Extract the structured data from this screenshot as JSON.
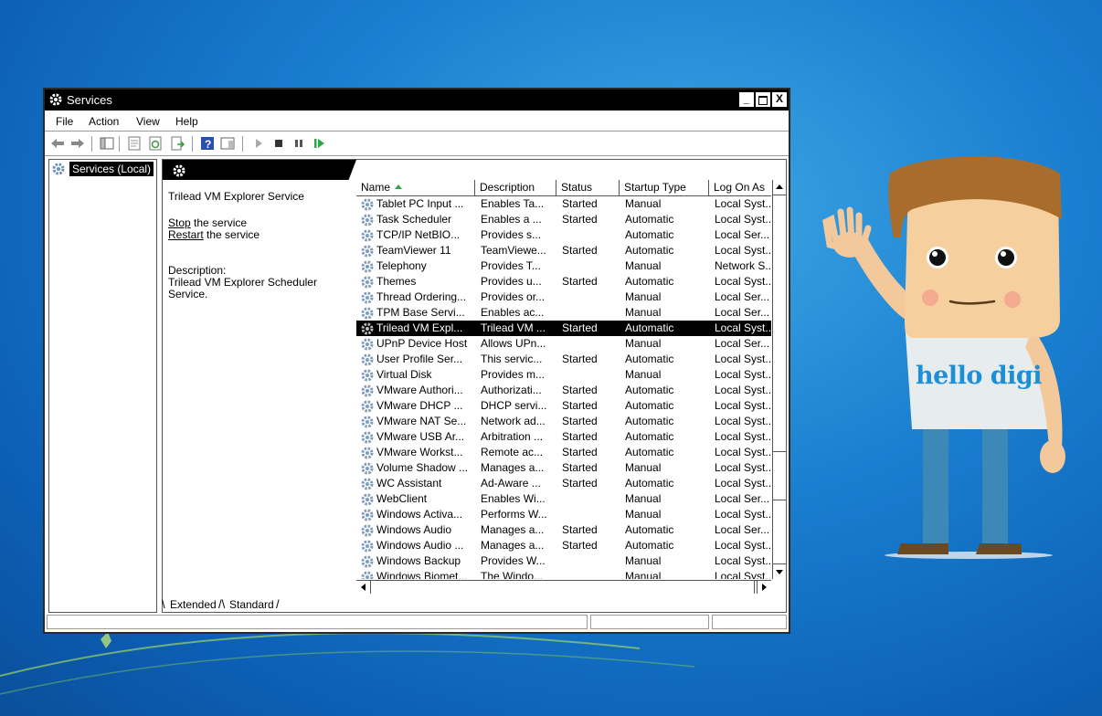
{
  "window": {
    "title": "Services",
    "controls": {
      "minimize": "_",
      "close": "X"
    }
  },
  "menu": [
    "File",
    "Action",
    "View",
    "Help"
  ],
  "tree": {
    "root": "Services (Local)"
  },
  "extended": {
    "service_name": "Trilead VM Explorer Service",
    "stop_link": "Stop",
    "stop_suffix": " the service",
    "restart_link": "Restart",
    "restart_suffix": " the service",
    "description_label": "Description:",
    "description": "Trilead VM Explorer Scheduler Service."
  },
  "columns": [
    "Name",
    "Description",
    "Status",
    "Startup Type",
    "Log On As"
  ],
  "services": [
    {
      "name": "Tablet PC Input ...",
      "description": "Enables Ta...",
      "status": "Started",
      "startup": "Manual",
      "logon": "Local Syst..."
    },
    {
      "name": "Task Scheduler",
      "description": "Enables a ...",
      "status": "Started",
      "startup": "Automatic",
      "logon": "Local Syst..."
    },
    {
      "name": "TCP/IP NetBIO...",
      "description": "Provides s...",
      "status": "",
      "startup": "Automatic",
      "logon": "Local Ser..."
    },
    {
      "name": "TeamViewer 11",
      "description": "TeamViewe...",
      "status": "Started",
      "startup": "Automatic",
      "logon": "Local Syst..."
    },
    {
      "name": "Telephony",
      "description": "Provides T...",
      "status": "",
      "startup": "Manual",
      "logon": "Network S..."
    },
    {
      "name": "Themes",
      "description": "Provides u...",
      "status": "Started",
      "startup": "Automatic",
      "logon": "Local Syst..."
    },
    {
      "name": "Thread Ordering...",
      "description": "Provides or...",
      "status": "",
      "startup": "Manual",
      "logon": "Local Ser..."
    },
    {
      "name": "TPM Base Servi...",
      "description": "Enables ac...",
      "status": "",
      "startup": "Manual",
      "logon": "Local Ser..."
    },
    {
      "name": "Trilead VM Expl...",
      "description": "Trilead VM ...",
      "status": "Started",
      "startup": "Automatic",
      "logon": "Local Syst...",
      "selected": true
    },
    {
      "name": "UPnP Device Host",
      "description": "Allows UPn...",
      "status": "",
      "startup": "Manual",
      "logon": "Local Ser..."
    },
    {
      "name": "User Profile Ser...",
      "description": "This servic...",
      "status": "Started",
      "startup": "Automatic",
      "logon": "Local Syst..."
    },
    {
      "name": "Virtual Disk",
      "description": "Provides m...",
      "status": "",
      "startup": "Manual",
      "logon": "Local Syst..."
    },
    {
      "name": "VMware Authori...",
      "description": "Authorizati...",
      "status": "Started",
      "startup": "Automatic",
      "logon": "Local Syst..."
    },
    {
      "name": "VMware DHCP ...",
      "description": "DHCP servi...",
      "status": "Started",
      "startup": "Automatic",
      "logon": "Local Syst..."
    },
    {
      "name": "VMware NAT Se...",
      "description": "Network ad...",
      "status": "Started",
      "startup": "Automatic",
      "logon": "Local Syst..."
    },
    {
      "name": "VMware USB Ar...",
      "description": "Arbitration ...",
      "status": "Started",
      "startup": "Automatic",
      "logon": "Local Syst..."
    },
    {
      "name": "VMware Workst...",
      "description": "Remote ac...",
      "status": "Started",
      "startup": "Automatic",
      "logon": "Local Syst..."
    },
    {
      "name": "Volume Shadow ...",
      "description": "Manages a...",
      "status": "Started",
      "startup": "Manual",
      "logon": "Local Syst..."
    },
    {
      "name": "WC Assistant",
      "description": "Ad-Aware ...",
      "status": "Started",
      "startup": "Automatic",
      "logon": "Local Syst..."
    },
    {
      "name": "WebClient",
      "description": "Enables Wi...",
      "status": "",
      "startup": "Manual",
      "logon": "Local Ser..."
    },
    {
      "name": "Windows Activa...",
      "description": "Performs W...",
      "status": "",
      "startup": "Manual",
      "logon": "Local Syst..."
    },
    {
      "name": "Windows Audio",
      "description": "Manages a...",
      "status": "Started",
      "startup": "Automatic",
      "logon": "Local Ser..."
    },
    {
      "name": "Windows Audio ...",
      "description": "Manages a...",
      "status": "Started",
      "startup": "Automatic",
      "logon": "Local Syst..."
    },
    {
      "name": "Windows Backup",
      "description": "Provides W...",
      "status": "",
      "startup": "Manual",
      "logon": "Local Syst..."
    },
    {
      "name": "Windows Biomet...",
      "description": "The Windo...",
      "status": "",
      "startup": "Manual",
      "logon": "Local Syst..."
    }
  ],
  "tabs": [
    "Extended",
    "Standard"
  ],
  "overlay": {
    "text": "hello digi",
    "color": "#1d8fd6"
  },
  "icons": [
    "gear-icon",
    "back-arrow-icon",
    "forward-arrow-icon",
    "play-icon",
    "stop-icon",
    "pause-icon",
    "resume-icon",
    "help-icon"
  ]
}
